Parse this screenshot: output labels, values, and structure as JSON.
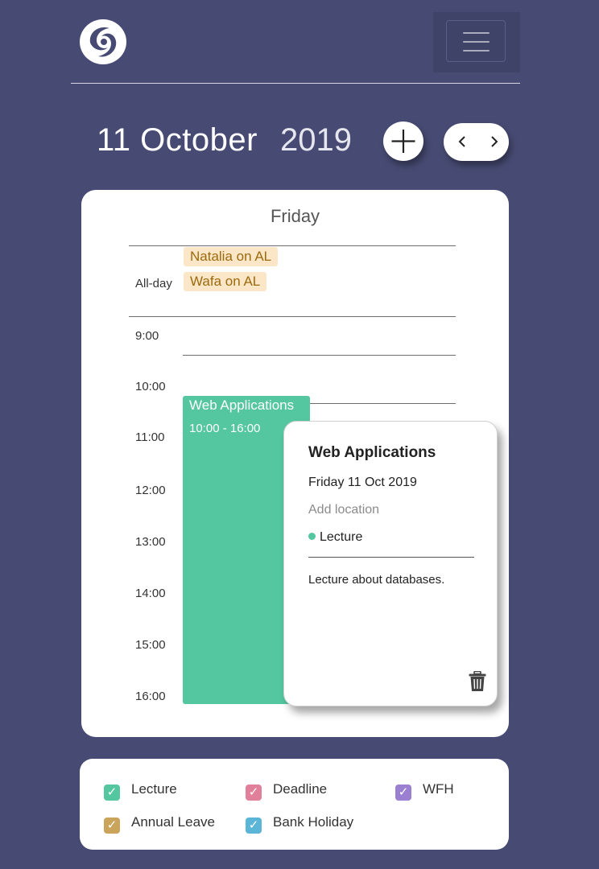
{
  "header": {
    "logo_icon": "swirl-logo-icon",
    "menu_icon": "hamburger-menu-icon"
  },
  "date": {
    "day_month": "11 October",
    "year": "2019",
    "add_icon": "plus-icon",
    "prev_icon": "chevron-left-icon",
    "next_icon": "chevron-right-icon"
  },
  "calendar": {
    "day_name": "Friday",
    "allday_label": "All-day",
    "allday_events": [
      "Natalia on AL",
      "Wafa on AL"
    ],
    "hours": [
      "9:00",
      "10:00",
      "11:00",
      "12:00",
      "13:00",
      "14:00",
      "15:00",
      "16:00"
    ],
    "event": {
      "title": "Web Applications",
      "time": "10:00 - 16:00",
      "color": "#54c6a0"
    }
  },
  "popup": {
    "title": "Web Applications",
    "date": "Friday 11 Oct 2019",
    "location_placeholder": "Add location",
    "category": "Lecture",
    "description": "Lecture about databases.",
    "delete_icon": "trash-icon"
  },
  "legend": {
    "items": [
      {
        "label": "Lecture",
        "color": "#54c6a0",
        "checked": true
      },
      {
        "label": "Deadline",
        "color": "#e1809a",
        "checked": true
      },
      {
        "label": "WFH",
        "color": "#9b7fd0",
        "checked": true
      },
      {
        "label": "Annual Leave",
        "color": "#c9a45a",
        "checked": true
      },
      {
        "label": "Bank Holiday",
        "color": "#5bb5d6",
        "checked": true
      }
    ]
  }
}
